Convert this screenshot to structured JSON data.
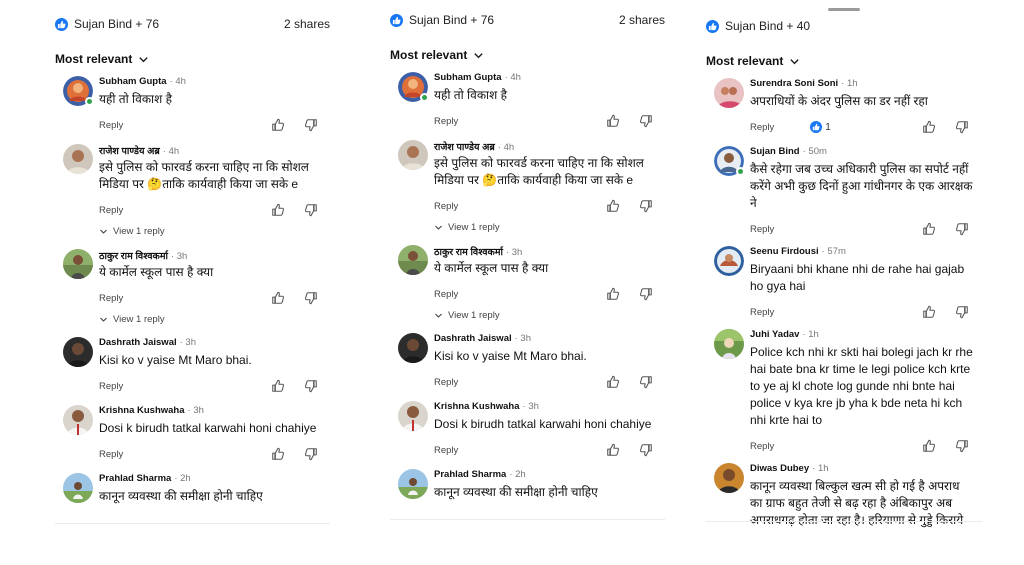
{
  "panels": [
    {
      "reactions_text": "Sujan Bind + 76",
      "shares": "2 shares",
      "sort_label": "Most relevant",
      "comments": [
        {
          "author": "Subham Gupta",
          "time": "· 4h",
          "text": "यही तो विकाश है",
          "reply": "Reply",
          "online": true
        },
        {
          "author": "राजेश पाण्डेय अब्र",
          "time": "· 4h",
          "text": "इसे पुलिस को फारवर्ड करना चाहिए ना कि सोशल मिडिया पर 🤔ताकि कार्यवाही किया जा सके e",
          "reply": "Reply",
          "view_replies": "View 1 reply"
        },
        {
          "author": "ठाकुर राम विश्वकर्मा",
          "time": "· 3h",
          "text": "ये कार्मेल स्कूल पास है क्या",
          "reply": "Reply",
          "view_replies": "View 1 reply"
        },
        {
          "author": "Dashrath Jaiswal",
          "time": "· 3h",
          "text": "Kisi ko v yaise Mt Maro bhai.",
          "reply": "Reply"
        },
        {
          "author": "Krishna Kushwaha",
          "time": "· 3h",
          "text": "Dosi k birudh tatkal karwahi honi chahiye",
          "reply": "Reply"
        },
        {
          "author": "Prahlad Sharma",
          "time": "· 2h",
          "text": "कानून व्यवस्था की समीक्षा होनी चाहिए"
        }
      ]
    },
    {
      "reactions_text": "Sujan Bind + 76",
      "shares": "2 shares",
      "sort_label": "Most relevant",
      "comments": [
        {
          "author": "Subham Gupta",
          "time": "· 4h",
          "text": "यही तो विकाश है",
          "reply": "Reply",
          "online": true
        },
        {
          "author": "राजेश पाण्डेय अब्र",
          "time": "· 4h",
          "text": "इसे पुलिस को फारवर्ड करना चाहिए ना कि सोशल मिडिया पर 🤔ताकि कार्यवाही किया जा सके e",
          "reply": "Reply",
          "view_replies": "View 1 reply"
        },
        {
          "author": "ठाकुर राम विश्वकर्मा",
          "time": "· 3h",
          "text": "ये कार्मेल स्कूल पास है क्या",
          "reply": "Reply",
          "view_replies": "View 1 reply"
        },
        {
          "author": "Dashrath Jaiswal",
          "time": "· 3h",
          "text": "Kisi ko v yaise Mt Maro bhai.",
          "reply": "Reply"
        },
        {
          "author": "Krishna Kushwaha",
          "time": "· 3h",
          "text": "Dosi k birudh tatkal karwahi honi chahiye",
          "reply": "Reply"
        },
        {
          "author": "Prahlad Sharma",
          "time": "· 2h",
          "text": "कानून व्यवस्था की समीक्षा होनी चाहिए"
        }
      ]
    },
    {
      "reactions_text": "Sujan Bind + 40",
      "sort_label": "Most relevant",
      "comments": [
        {
          "author": "Surendra Soni Soni",
          "time": "· 1h",
          "text": "अपराधियों के अंदर पुलिस का डर नहीं रहा",
          "reply": "Reply",
          "likes": "1"
        },
        {
          "author": "Sujan Bind",
          "time": "· 50m",
          "text": "कैसे रहेगा जब उच्च अधिकारी पुलिस का सपोर्ट नहीं करेंगे अभी कुछ दिनों हुआ गांधीनगर के एक आरक्षक ने",
          "reply": "Reply",
          "online": true
        },
        {
          "author": "Seenu Firdousi",
          "time": "· 57m",
          "text": "Biryaani bhi khane nhi de rahe hai gajab ho gya hai",
          "reply": "Reply"
        },
        {
          "author": "Juhi Yadav",
          "time": "· 1h",
          "text": "Police kch nhi kr skti hai bolegi jach kr rhe hai bate bna kr time le legi police kch krte to ye aj kl chote log gunde nhi bnte hai police v kya kre jb yha k bde neta hi kch nhi krte hai to",
          "reply": "Reply"
        },
        {
          "author": "Diwas Dubey",
          "time": "· 1h",
          "text": "कानून व्यवस्था बिल्कुल खत्म सी हो गई है अपराध का ग्राफ बहुत तेजी से बढ़ रहा है अंबिकापुर अब अपराधगढ़ होता जा रहा है। हरियाणा से गुड्डे किराये"
        }
      ]
    }
  ]
}
